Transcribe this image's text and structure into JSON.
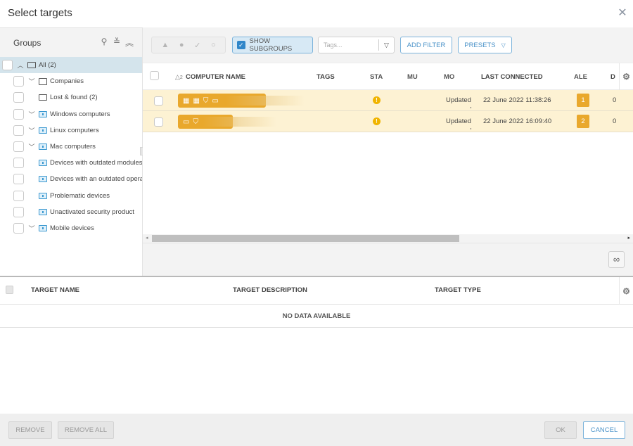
{
  "dialog": {
    "title": "Select targets",
    "close_icon": "close-icon"
  },
  "groups": {
    "header": "Groups",
    "tools": [
      "search-icon",
      "expand-all-icon",
      "collapse-all-icon"
    ],
    "items": [
      {
        "label": "All (2)",
        "level": 0,
        "chevron": "up",
        "icon": "folder",
        "selected": true
      },
      {
        "label": "Companies",
        "level": 1,
        "chevron": "down",
        "icon": "organization"
      },
      {
        "label": "Lost & found (2)",
        "level": 1,
        "chevron": "none",
        "icon": "folder"
      },
      {
        "label": "Windows computers",
        "level": 1,
        "chevron": "down",
        "icon": "dynamic-folder"
      },
      {
        "label": "Linux computers",
        "level": 1,
        "chevron": "down",
        "icon": "dynamic-folder"
      },
      {
        "label": "Mac computers",
        "level": 1,
        "chevron": "down",
        "icon": "dynamic-folder"
      },
      {
        "label": "Devices with outdated modules",
        "level": 1,
        "chevron": "none",
        "icon": "dynamic-folder"
      },
      {
        "label": "Devices with an outdated operat",
        "level": 1,
        "chevron": "none",
        "icon": "dynamic-folder"
      },
      {
        "label": "Problematic devices",
        "level": 1,
        "chevron": "none",
        "icon": "dynamic-folder"
      },
      {
        "label": "Unactivated security product",
        "level": 1,
        "chevron": "none",
        "icon": "dynamic-folder"
      },
      {
        "label": "Mobile devices",
        "level": 1,
        "chevron": "down",
        "icon": "dynamic-folder"
      }
    ]
  },
  "toolbar": {
    "status_filters": [
      "warning-icon",
      "error-icon",
      "ok-check-icon",
      "none-circle-icon"
    ],
    "show_subgroups_label": "SHOW SUBGROUPS",
    "show_subgroups_checked": true,
    "tags_placeholder": "Tags...",
    "add_filter_label": "ADD FILTER",
    "presets_label": "PRESETS"
  },
  "computers": {
    "columns": {
      "sort_indicator": "△",
      "sort_order": "2",
      "name": "COMPUTER NAME",
      "tags": "TAGS",
      "status": "STA",
      "muted": "MU",
      "modules": "MO",
      "last_connected": "LAST CONNECTED",
      "alerts": "ALE",
      "detections": "D"
    },
    "rows": [
      {
        "icons": [
          "grid-icon",
          "grid-icon",
          "shield-check-icon",
          "monitor-chat-icon"
        ],
        "status": "!",
        "modules": "Updated",
        "last_connected": "22 June 2022 11:38:26",
        "alerts": "1",
        "detections": "0"
      },
      {
        "icons": [
          "monitor-icon",
          "shield-check-icon"
        ],
        "status": "!",
        "modules": "Updated",
        "last_connected": "22 June 2022 16:09:40",
        "alerts": "2",
        "detections": "0"
      }
    ],
    "scroll_left": "◂",
    "scroll_right": "▸",
    "infinite_icon": "∞",
    "accent": "#e9a82c",
    "row_bg": "#fdf2d3"
  },
  "targets": {
    "columns": {
      "name": "TARGET NAME",
      "description": "TARGET DESCRIPTION",
      "type": "TARGET TYPE"
    },
    "empty": "NO DATA AVAILABLE"
  },
  "footer": {
    "remove": "REMOVE",
    "remove_all": "REMOVE ALL",
    "ok": "OK",
    "cancel": "CANCEL"
  }
}
